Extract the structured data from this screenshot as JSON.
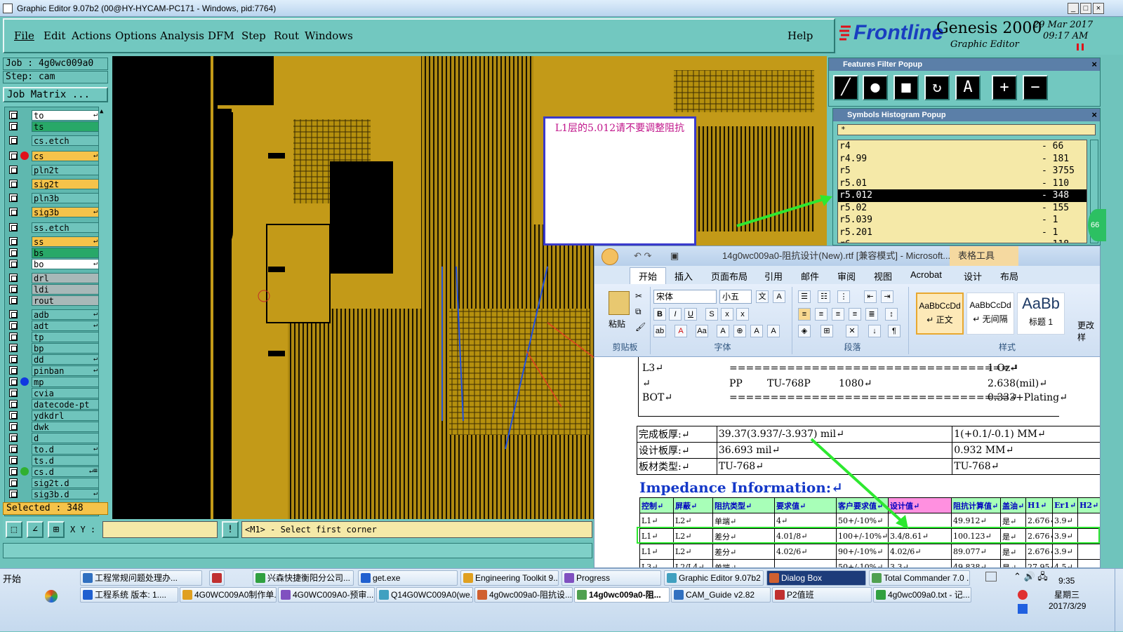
{
  "window": {
    "title": "Graphic Editor 9.07b2 (00@HY-HYCAM-PC171 - Windows, pid:7764)",
    "btn_min": "_",
    "btn_max": "□",
    "btn_close": "×"
  },
  "menu": [
    "File",
    "Edit",
    "Actions",
    "Options",
    "Analysis",
    "DFM",
    "Step",
    "Rout",
    "Windows"
  ],
  "menu_help": "Help",
  "brand": {
    "logo": "Frontline",
    "product": "Genesis 2000",
    "subtitle": "Graphic Editor",
    "date": "29 Mar 2017",
    "time": "09:17 AM"
  },
  "job": {
    "job_label": "Job : 4g0wc009a0",
    "step_label": "Step: cam",
    "matrix_button": "Job Matrix ..."
  },
  "layers": [
    {
      "name": "to",
      "style": "sel-w",
      "flag": "↵"
    },
    {
      "name": "ts",
      "style": "sel-g",
      "flag": ""
    },
    {
      "name": "cs.etch",
      "style": "",
      "flag": ""
    },
    {
      "name": "cs",
      "style": "sel-y",
      "flag": "↵",
      "dot": "#e0101a"
    },
    {
      "name": "pln2t",
      "style": "",
      "flag": ""
    },
    {
      "name": "sig2t",
      "style": "sel-y",
      "flag": ""
    },
    {
      "name": "pln3b",
      "style": "",
      "flag": ""
    },
    {
      "name": "sig3b",
      "style": "sel-y",
      "flag": "↵"
    },
    {
      "name": "ss.etch",
      "style": "",
      "flag": ""
    },
    {
      "name": "ss",
      "style": "sel-y",
      "flag": "↵"
    },
    {
      "name": "bs",
      "style": "sel-g",
      "flag": ""
    },
    {
      "name": "bo",
      "style": "sel-w",
      "flag": "↵"
    },
    {
      "name": "drl",
      "style": "sel-gr",
      "flag": ""
    },
    {
      "name": "ldi",
      "style": "sel-gr",
      "flag": ""
    },
    {
      "name": "rout",
      "style": "sel-gr",
      "flag": ""
    },
    {
      "name": "adb",
      "style": "",
      "flag": "↵"
    },
    {
      "name": "adt",
      "style": "",
      "flag": "↵"
    },
    {
      "name": "tp",
      "style": "",
      "flag": ""
    },
    {
      "name": "bp",
      "style": "",
      "flag": ""
    },
    {
      "name": "dd",
      "style": "",
      "flag": "↵"
    },
    {
      "name": "pinban",
      "style": "",
      "flag": "↵"
    },
    {
      "name": "mp",
      "style": "",
      "flag": "",
      "dot": "#1038e0"
    },
    {
      "name": "cvia",
      "style": "",
      "flag": ""
    },
    {
      "name": "datecode-pt",
      "style": "",
      "flag": ""
    },
    {
      "name": "ydkdrl",
      "style": "",
      "flag": ""
    },
    {
      "name": "dwk",
      "style": "",
      "flag": ""
    },
    {
      "name": "d",
      "style": "",
      "flag": ""
    },
    {
      "name": "to.d",
      "style": "",
      "flag": "↵"
    },
    {
      "name": "ts.d",
      "style": "",
      "flag": ""
    },
    {
      "name": "cs.d",
      "style": "",
      "flag": "↵≡",
      "dot": "#30b030"
    },
    {
      "name": "sig2t.d",
      "style": "",
      "flag": ""
    },
    {
      "name": "sig3b.d",
      "style": "",
      "flag": "↵"
    }
  ],
  "selected": "Selected : 348",
  "bottom": {
    "xy_label": "X Y :",
    "prompt": "<M1> - Select first corner",
    "info_btn": "!"
  },
  "features_filter": {
    "title": "Features Filter Popup",
    "close": "×"
  },
  "symbols_histogram": {
    "title": "Symbols Histogram Popup",
    "close": "×",
    "filter": "*",
    "rows": [
      {
        "sym": "r4",
        "count": "- 66"
      },
      {
        "sym": "r4.99",
        "count": "- 181"
      },
      {
        "sym": "r5",
        "count": "- 3755"
      },
      {
        "sym": "r5.01",
        "count": "- 110"
      },
      {
        "sym": "r5.012",
        "count": "- 348",
        "sel": true
      },
      {
        "sym": "r5.02",
        "count": "- 155"
      },
      {
        "sym": "r5.039",
        "count": "- 1"
      },
      {
        "sym": "r5.201",
        "count": "- 1"
      },
      {
        "sym": "r6",
        "count": "- 118"
      }
    ]
  },
  "note": "L1层的5.012请不要调整阻抗",
  "badge": "66",
  "word": {
    "title": "14g0wc009a0-阻抗设计(New).rtf [兼容模式] - Microsoft...",
    "context_tab": "表格工具",
    "tabs": [
      "开始",
      "插入",
      "页面布局",
      "引用",
      "邮件",
      "审阅",
      "视图",
      "Acrobat",
      "设计",
      "布局"
    ],
    "paste": "粘贴",
    "clipboard": "剪贴板",
    "font_name": "宋体",
    "font_size": "小五",
    "font_group": "字体",
    "para_group": "段落",
    "style_group": "样式",
    "styles": [
      {
        "sample": "AaBbCcDd",
        "name": "↵ 正文"
      },
      {
        "sample": "AaBbCcDd",
        "name": "↵ 无间隔"
      },
      {
        "sample": "AaBb",
        "name": "标题 1"
      }
    ],
    "change_style": "更改样",
    "stack": [
      {
        "a": "L3↵",
        "b": "",
        "c": "",
        "d": "==================================↵",
        "e": "1 Oz↵"
      },
      {
        "a": "↵",
        "b": "PP",
        "c": "TU-768P",
        "d": "1080↵",
        "e": "2.638(mil)↵"
      },
      {
        "a": "BOT↵",
        "b": "",
        "c": "",
        "d": "==================================↵",
        "e": "0.333+Plating↵"
      }
    ],
    "board": [
      [
        "完成板厚:↵",
        "39.37(3.937/-3.937) mil↵",
        "1(+0.1/-0.1) MM↵"
      ],
      [
        "设计板厚:↵",
        "36.693 mil↵",
        "0.932 MM↵"
      ],
      [
        "板材类型:↵",
        "TU-768↵",
        "TU-768↵"
      ]
    ],
    "impedance_heading": "Impedance Information:↵",
    "imp_header": [
      "控制↵",
      "屏蔽↵",
      "阻抗类型↵",
      "要求值↵",
      "客户要求值↵",
      "设计值↵",
      "阻抗计算值↵",
      "盖油↵",
      "H1↵",
      "Er1↵",
      "H2↵"
    ],
    "imp_rows": [
      [
        "L1↵",
        "L2↵",
        "单端↵",
        "4↵",
        "50+/-10%↵",
        "",
        "49.912↵",
        "是↵",
        "2.676↵",
        "3.9↵",
        ""
      ],
      [
        "L1↵",
        "L2↵",
        "差分↵",
        "4.01/8↵",
        "100+/-10%↵",
        "3.4/8.61↵",
        "100.123↵",
        "是↵",
        "2.676↵",
        "3.9↵",
        ""
      ],
      [
        "L1↵",
        "L2↵",
        "差分↵",
        "4.02/6↵",
        "90+/-10%↵",
        "4.02/6↵",
        "89.077↵",
        "是↵",
        "2.676↵",
        "3.9↵",
        ""
      ],
      [
        "L3↵",
        "L2/L4↵",
        "单端↵",
        "",
        "50+/-10%↵",
        "3.3↵",
        "49.838↵",
        "是↵",
        "27.95↵",
        "4.5↵",
        ""
      ]
    ]
  },
  "taskbar": {
    "start": "开始",
    "row1": [
      "工程常规问题处理办...",
      "",
      "兴森快捷衡阳分公司...",
      "get.exe",
      "Engineering Toolkit 9....",
      "Progress",
      "Graphic Editor 9.07b2 ...",
      "Dialog Box",
      "Total Commander 7.0 ..."
    ],
    "row2": [
      "工程系统  版本: 1....",
      "4G0WC009A0制作单...",
      "4G0WC009A0-预审...",
      "Q14G0WC009A0(we...",
      "4g0wc009a0-阻抗设...",
      "14g0wc009a0-阻...",
      "CAM_Guide v2.82",
      "P2值班",
      "4g0wc009a0.txt - 记..."
    ],
    "clock_time": "9:35",
    "clock_day": "星期三",
    "clock_date": "2017/3/29"
  }
}
